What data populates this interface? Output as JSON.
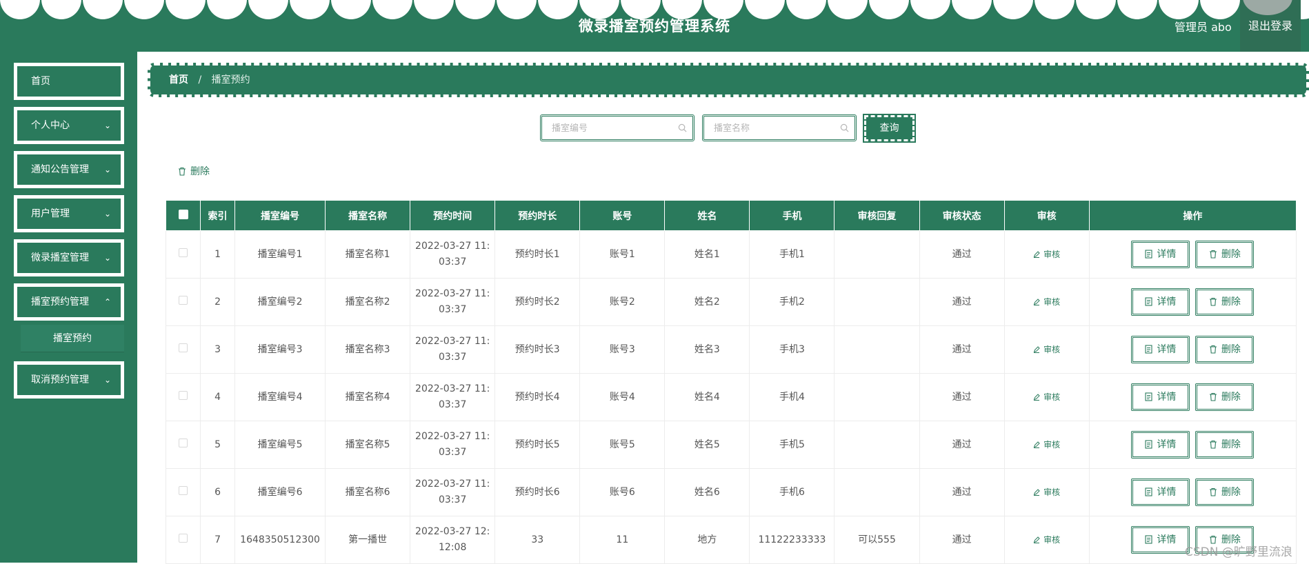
{
  "header": {
    "title": "微录播室预约管理系统",
    "admin_label": "管理员 abo",
    "logout_label": "退出登录",
    "brand_color": "#2a7a5c"
  },
  "sidebar": {
    "items": [
      {
        "label": "首页",
        "has_children": false
      },
      {
        "label": "个人中心",
        "has_children": true
      },
      {
        "label": "通知公告管理",
        "has_children": true
      },
      {
        "label": "用户管理",
        "has_children": true
      },
      {
        "label": "微录播室管理",
        "has_children": true
      },
      {
        "label": "播室预约管理",
        "has_children": true
      },
      {
        "label": "取消预约管理",
        "has_children": true
      }
    ],
    "open_submenu": {
      "label": "播室预约"
    }
  },
  "breadcrumb": {
    "home": "首页",
    "separator": "/",
    "current": "播室预约"
  },
  "search": {
    "room_no_placeholder": "播室编号",
    "room_name_placeholder": "播室名称",
    "query_label": "查询"
  },
  "toolbar": {
    "delete_label": "删除"
  },
  "table": {
    "columns": [
      "索引",
      "播室编号",
      "播室名称",
      "预约时间",
      "预约时长",
      "账号",
      "姓名",
      "手机",
      "审核回复",
      "审核状态",
      "审核",
      "操作"
    ],
    "rows": [
      {
        "index": "1",
        "room_no": "播室编号1",
        "room_name": "播室名称1",
        "time_line1": "2022-03-27 11:",
        "time_line2": "03:37",
        "duration": "预约时长1",
        "account": "账号1",
        "name": "姓名1",
        "phone": "手机1",
        "reply": "",
        "status": "通过"
      },
      {
        "index": "2",
        "room_no": "播室编号2",
        "room_name": "播室名称2",
        "time_line1": "2022-03-27 11:",
        "time_line2": "03:37",
        "duration": "预约时长2",
        "account": "账号2",
        "name": "姓名2",
        "phone": "手机2",
        "reply": "",
        "status": "通过"
      },
      {
        "index": "3",
        "room_no": "播室编号3",
        "room_name": "播室名称3",
        "time_line1": "2022-03-27 11:",
        "time_line2": "03:37",
        "duration": "预约时长3",
        "account": "账号3",
        "name": "姓名3",
        "phone": "手机3",
        "reply": "",
        "status": "通过"
      },
      {
        "index": "4",
        "room_no": "播室编号4",
        "room_name": "播室名称4",
        "time_line1": "2022-03-27 11:",
        "time_line2": "03:37",
        "duration": "预约时长4",
        "account": "账号4",
        "name": "姓名4",
        "phone": "手机4",
        "reply": "",
        "status": "通过"
      },
      {
        "index": "5",
        "room_no": "播室编号5",
        "room_name": "播室名称5",
        "time_line1": "2022-03-27 11:",
        "time_line2": "03:37",
        "duration": "预约时长5",
        "account": "账号5",
        "name": "姓名5",
        "phone": "手机5",
        "reply": "",
        "status": "通过"
      },
      {
        "index": "6",
        "room_no": "播室编号6",
        "room_name": "播室名称6",
        "time_line1": "2022-03-27 11:",
        "time_line2": "03:37",
        "duration": "预约时长6",
        "account": "账号6",
        "name": "姓名6",
        "phone": "手机6",
        "reply": "",
        "status": "通过"
      },
      {
        "index": "7",
        "room_no": "1648350512300",
        "room_name": "第一播世",
        "time_line1": "2022-03-27 12:",
        "time_line2": "12:08",
        "duration": "33",
        "account": "11",
        "name": "地方",
        "phone": "11122233333",
        "reply": "可以555",
        "status": "通过"
      }
    ],
    "audit_link_label": "审核",
    "detail_label": "详情",
    "delete_label": "删除"
  },
  "watermark": "CSDN @旷野里流浪"
}
